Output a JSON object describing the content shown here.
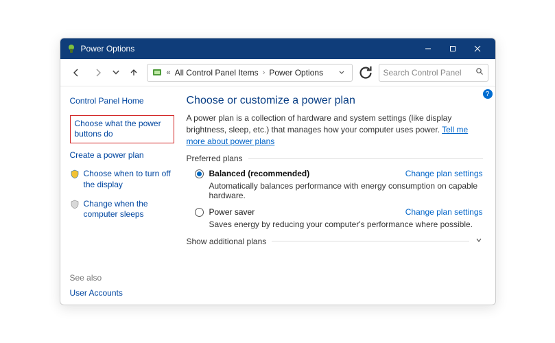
{
  "window": {
    "title": "Power Options"
  },
  "address": {
    "crumb1": "All Control Panel Items",
    "crumb2": "Power Options"
  },
  "search": {
    "placeholder": "Search Control Panel"
  },
  "sidebar": {
    "home": "Control Panel Home",
    "link_buttons": "Choose what the power buttons do",
    "link_create": "Create a power plan",
    "link_display": "Choose when to turn off the display",
    "link_sleep": "Change when the computer sleeps"
  },
  "seealso": {
    "header": "See also",
    "user_accounts": "User Accounts"
  },
  "main": {
    "heading": "Choose or customize a power plan",
    "description": "A power plan is a collection of hardware and system settings (like display brightness, sleep, etc.) that manages how your computer uses power. ",
    "tellme": "Tell me more about power plans",
    "preferred_label": "Preferred plans",
    "plan1_name": "Balanced (recommended)",
    "plan1_desc": "Automatically balances performance with energy consumption on capable hardware.",
    "plan2_name": "Power saver",
    "plan2_desc": "Saves energy by reducing your computer's performance where possible.",
    "change_link": "Change plan settings",
    "show_additional": "Show additional plans"
  }
}
